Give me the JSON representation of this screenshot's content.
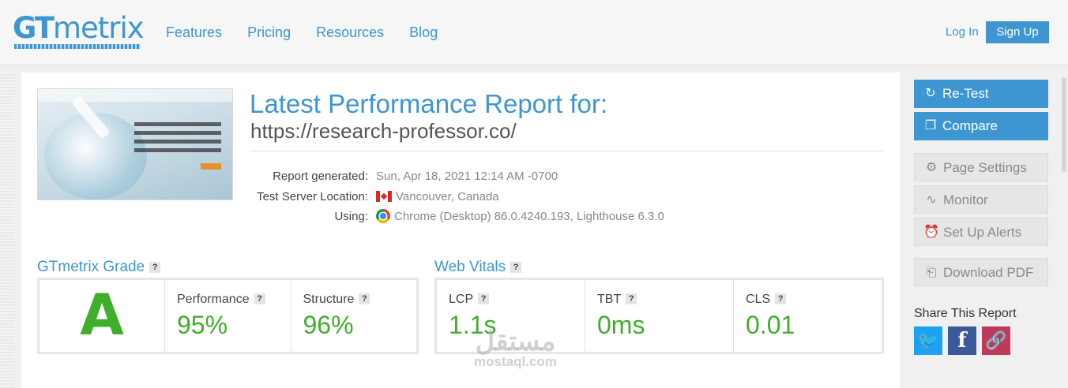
{
  "header": {
    "logo_gt": "GT",
    "logo_metrix": "metrix",
    "nav": [
      "Features",
      "Pricing",
      "Resources",
      "Blog"
    ],
    "login_label": "Log In",
    "signup_label": "Sign Up"
  },
  "report": {
    "title": "Latest Performance Report for:",
    "url": "https://research-professor.co/",
    "rows": [
      {
        "key": "Report generated:",
        "value": "Sun, Apr 18, 2021 12:14 AM -0700"
      },
      {
        "key": "Test Server Location:",
        "value": "Vancouver, Canada"
      },
      {
        "key": "Using:",
        "value": "Chrome (Desktop) 86.0.4240.193, Lighthouse 6.3.0"
      }
    ]
  },
  "grades": {
    "title": "GTmetrix Grade",
    "help": "?",
    "grade": "A",
    "metrics": [
      {
        "label": "Performance",
        "value": "95%"
      },
      {
        "label": "Structure",
        "value": "96%"
      }
    ]
  },
  "vitals": {
    "title": "Web Vitals",
    "help": "?",
    "metrics": [
      {
        "label": "LCP",
        "value": "1.1s"
      },
      {
        "label": "TBT",
        "value": "0ms"
      },
      {
        "label": "CLS",
        "value": "0.01"
      }
    ]
  },
  "sidebar": {
    "retest": "Re-Test",
    "compare": "Compare",
    "page_settings": "Page Settings",
    "monitor": "Monitor",
    "alerts": "Set Up Alerts",
    "pdf": "Download PDF",
    "share_title": "Share This Report"
  },
  "watermark": {
    "arabic": "مستقل",
    "latin": "mostaql.com"
  },
  "colors": {
    "brand": "#3d96d2",
    "grade_green": "#3fae2a",
    "twitter": "#1da1f2",
    "facebook": "#3b5998",
    "link_share": "#c0395a"
  }
}
